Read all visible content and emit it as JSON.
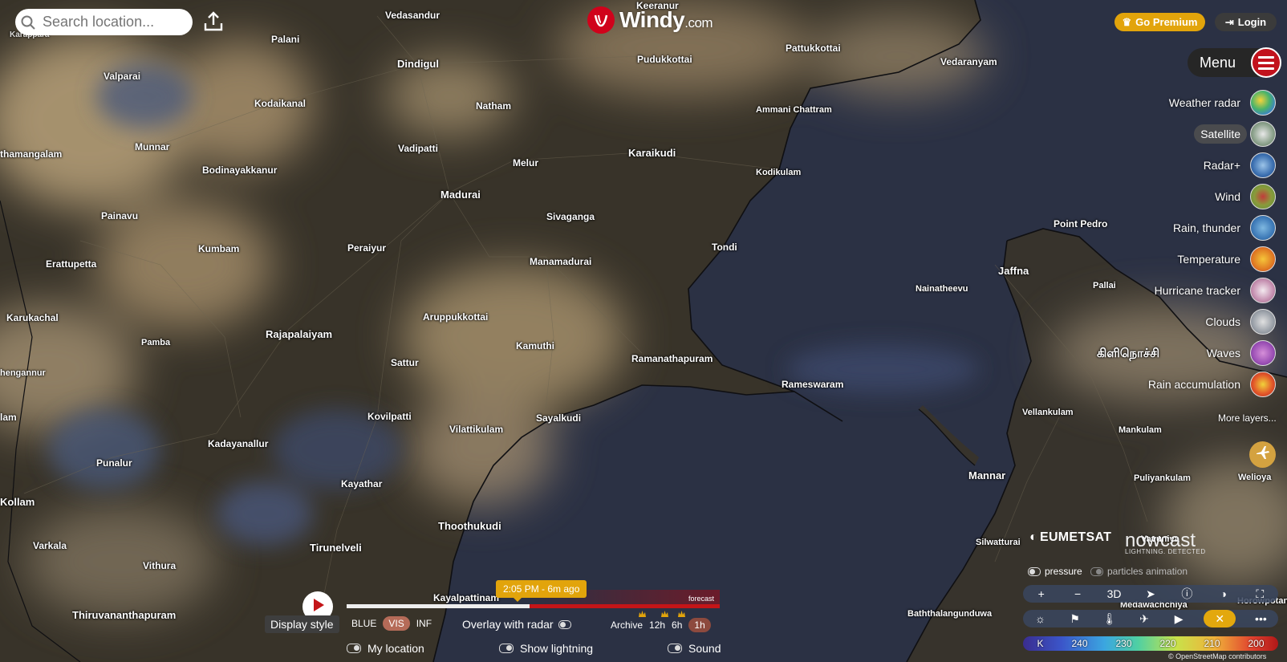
{
  "search": {
    "placeholder": "Search location..."
  },
  "logo": {
    "name": "Windy",
    "suffix": ".com"
  },
  "header": {
    "premium_label": "Go Premium",
    "login_label": "Login",
    "menu_label": "Menu"
  },
  "layers": [
    {
      "label": "Weather radar",
      "active": false
    },
    {
      "label": "Satellite",
      "active": true
    },
    {
      "label": "Radar+",
      "active": false
    },
    {
      "label": "Wind",
      "active": false
    },
    {
      "label": "Rain, thunder",
      "active": false
    },
    {
      "label": "Temperature",
      "active": false
    },
    {
      "label": "Hurricane tracker",
      "active": false
    },
    {
      "label": "Clouds",
      "active": false
    },
    {
      "label": "Waves",
      "active": false
    },
    {
      "label": "Rain accumulation",
      "active": false
    }
  ],
  "more_layers_label": "More layers...",
  "attribution": {
    "eumetsat": "EUMETSAT",
    "nowcast": "nowcast",
    "nowcast_sub": "LIGHTNING. DETECTED",
    "osm": "© OpenStreetMap contributors"
  },
  "map_options": {
    "pressure_label": "pressure",
    "particles_label": "particles animation"
  },
  "controls": {
    "threed_label": "3D"
  },
  "scale": {
    "unit": "K",
    "ticks": [
      "240",
      "230",
      "220",
      "210",
      "200"
    ]
  },
  "timeline": {
    "display_style_label": "Display style",
    "vis_options": [
      "BLUE",
      "VIS",
      "INF"
    ],
    "vis_selected": "VIS",
    "time_label": "2:05 PM - 6m ago",
    "forecast_label": "forecast",
    "progress": 0.49,
    "overlay_radar_label": "Overlay with radar",
    "archive_label": "Archive",
    "range_options": [
      "12h",
      "6h",
      "1h"
    ],
    "range_selected": "1h"
  },
  "bottom_toggles": {
    "my_location_label": "My location",
    "lightning_label": "Show lightning",
    "sound_label": "Sound"
  },
  "colors": {
    "accent": "#e2a40b",
    "brand": "#d0021b",
    "sea": "#2a3042"
  },
  "cities": [
    {
      "name": "Karappara"
    },
    {
      "name": "Vedasandur"
    },
    {
      "name": "Keeranur"
    },
    {
      "name": "Palani"
    },
    {
      "name": "Dindigul"
    },
    {
      "name": "Pudukkottai"
    },
    {
      "name": "Pattukkottai"
    },
    {
      "name": "Vedaranyam"
    },
    {
      "name": "Valparai"
    },
    {
      "name": "Kodaikanal"
    },
    {
      "name": "Natham"
    },
    {
      "name": "Ammani Chattram"
    },
    {
      "name": "thamangalam"
    },
    {
      "name": "Munnar"
    },
    {
      "name": "Vadipatti"
    },
    {
      "name": "Melur"
    },
    {
      "name": "Karaikudi"
    },
    {
      "name": "Bodinayakkanur"
    },
    {
      "name": "Kodikulam"
    },
    {
      "name": "Madurai"
    },
    {
      "name": "Sivaganga"
    },
    {
      "name": "Painavu"
    },
    {
      "name": "Point Pedro"
    },
    {
      "name": "Kumbam"
    },
    {
      "name": "Peraiyur"
    },
    {
      "name": "Tondi"
    },
    {
      "name": "Erattupetta"
    },
    {
      "name": "Manamadurai"
    },
    {
      "name": "Jaffna"
    },
    {
      "name": "Nainatheevu"
    },
    {
      "name": "Pallai"
    },
    {
      "name": "Karukachal"
    },
    {
      "name": "Aruppukkottai"
    },
    {
      "name": "Rajapalaiyam"
    },
    {
      "name": "Pamba"
    },
    {
      "name": "Kamuthi"
    },
    {
      "name": "கிளிநொச்சி"
    },
    {
      "name": "Ramanathapuram"
    },
    {
      "name": "Sattur"
    },
    {
      "name": "hengannur"
    },
    {
      "name": "Rameswaram"
    },
    {
      "name": "Vellankulam"
    },
    {
      "name": "Kovilpatti"
    },
    {
      "name": "Sayalkudi"
    },
    {
      "name": "Vilattikulam"
    },
    {
      "name": "lam"
    },
    {
      "name": "Mankulam"
    },
    {
      "name": "Kadayanallur"
    },
    {
      "name": "Punalur"
    },
    {
      "name": "Mannar"
    },
    {
      "name": "Puliyankulam"
    },
    {
      "name": "Welioya"
    },
    {
      "name": "Kayathar"
    },
    {
      "name": "Kollam"
    },
    {
      "name": "Thoothukudi"
    },
    {
      "name": "Silwatturai"
    },
    {
      "name": "Vavuniya"
    },
    {
      "name": "Varkala"
    },
    {
      "name": "Tirunelveli"
    },
    {
      "name": "Vithura"
    },
    {
      "name": "Kayalpattinam"
    },
    {
      "name": "Thiruvananthapuram"
    },
    {
      "name": "Baththalangunduwa"
    },
    {
      "name": "Medawachchiya"
    },
    {
      "name": "Horowpotana"
    }
  ]
}
